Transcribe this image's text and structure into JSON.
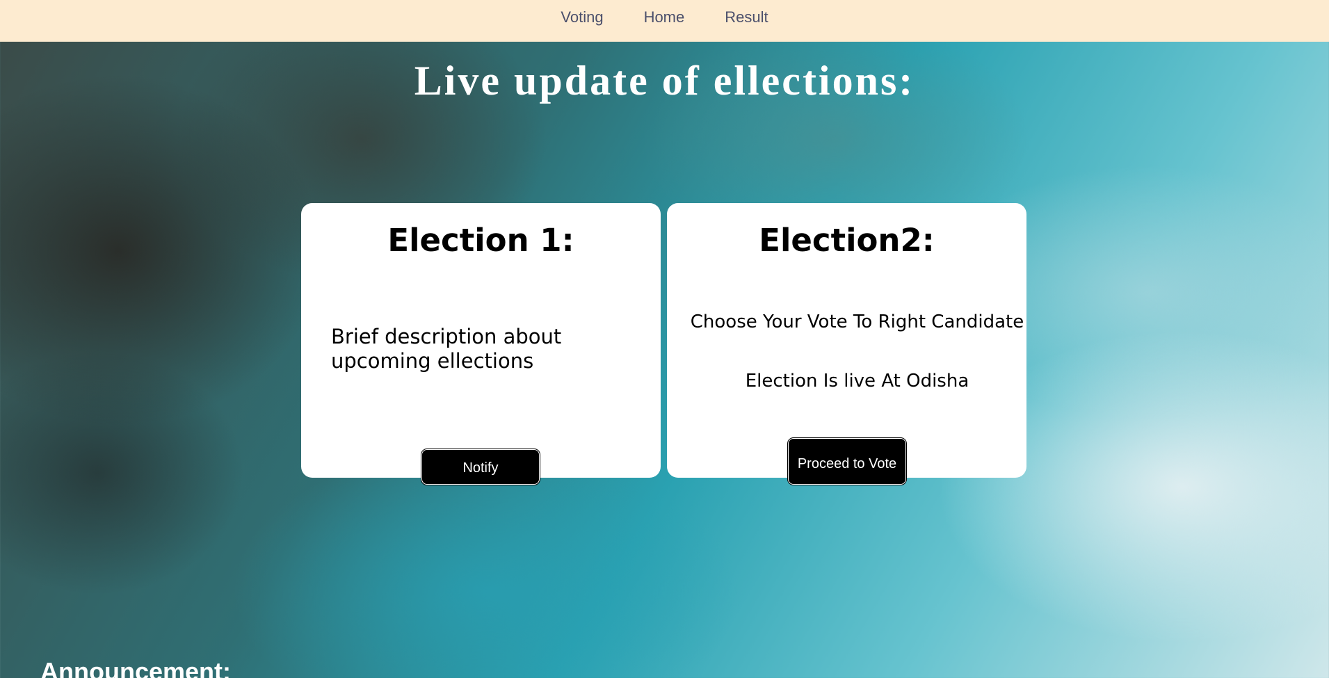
{
  "nav": {
    "items": [
      {
        "label": "Voting"
      },
      {
        "label": "Home"
      },
      {
        "label": "Result"
      }
    ]
  },
  "hero": {
    "title": "Live update of ellections:"
  },
  "cards": [
    {
      "heading": "Election 1:",
      "description": "Brief description about upcoming ellections",
      "button_label": "Notify"
    },
    {
      "heading": "Election2:",
      "line_1": "Choose Your Vote To Right Candidate",
      "line_2": "Election Is live At Odisha",
      "button_label": "Proceed to Vote"
    }
  ],
  "announcement": {
    "heading": "Announcement:"
  },
  "colors": {
    "navbar_bg": "#fdebd0",
    "nav_text": "#4b4f6b",
    "card_bg": "#ffffff",
    "button_bg": "#000000"
  }
}
